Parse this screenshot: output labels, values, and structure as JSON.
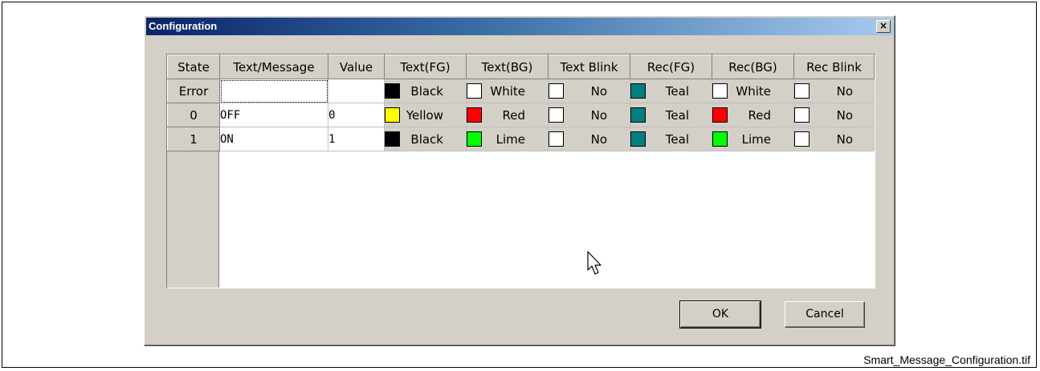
{
  "caption": "Smart_Message_Configuration.tif",
  "dialog": {
    "title": "Configuration",
    "close_glyph": "×",
    "ok_label": "OK",
    "cancel_label": "Cancel"
  },
  "table": {
    "headers": [
      "State",
      "Text/Message",
      "Value",
      "Text(FG)",
      "Text(BG)",
      "Text Blink",
      "Rec(FG)",
      "Rec(BG)",
      "Rec Blink"
    ],
    "rows": [
      {
        "state": "Error",
        "text": "",
        "value": "",
        "text_fg": {
          "label": "Black",
          "color": "#000000"
        },
        "text_bg": {
          "label": "White",
          "color": "#ffffff"
        },
        "text_blink": {
          "label": "No",
          "color": "#ffffff"
        },
        "rec_fg": {
          "label": "Teal",
          "color": "#008080"
        },
        "rec_bg": {
          "label": "White",
          "color": "#ffffff"
        },
        "rec_blink": {
          "label": "No",
          "color": "#ffffff"
        }
      },
      {
        "state": "0",
        "text": "OFF",
        "value": "0",
        "text_fg": {
          "label": "Yellow",
          "color": "#ffff00"
        },
        "text_bg": {
          "label": "Red",
          "color": "#ff0000"
        },
        "text_blink": {
          "label": "No",
          "color": "#ffffff"
        },
        "rec_fg": {
          "label": "Teal",
          "color": "#008080"
        },
        "rec_bg": {
          "label": "Red",
          "color": "#ff0000"
        },
        "rec_blink": {
          "label": "No",
          "color": "#ffffff"
        }
      },
      {
        "state": "1",
        "text": "ON",
        "value": "1",
        "text_fg": {
          "label": "Black",
          "color": "#000000"
        },
        "text_bg": {
          "label": "Lime",
          "color": "#00ff00"
        },
        "text_blink": {
          "label": "No",
          "color": "#ffffff"
        },
        "rec_fg": {
          "label": "Teal",
          "color": "#008080"
        },
        "rec_bg": {
          "label": "Lime",
          "color": "#00ff00"
        },
        "rec_blink": {
          "label": "No",
          "color": "#ffffff"
        }
      }
    ]
  }
}
